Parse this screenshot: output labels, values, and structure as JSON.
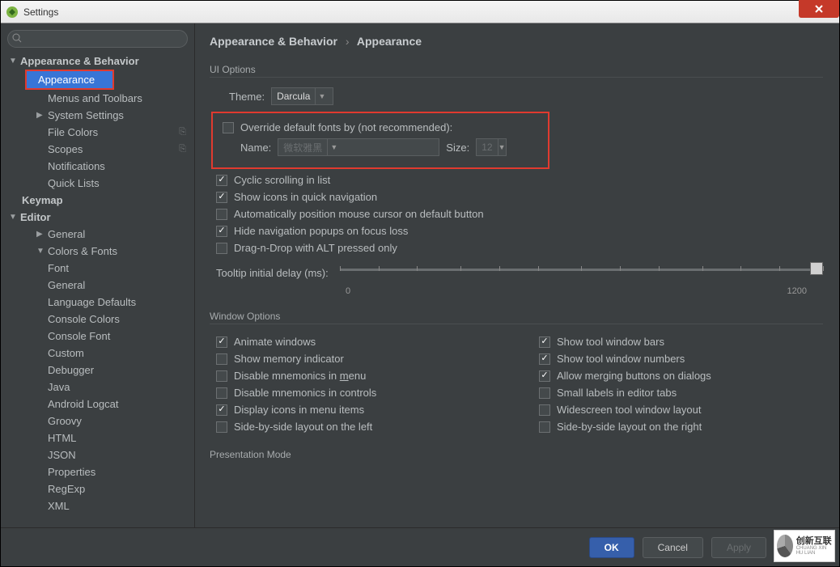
{
  "window": {
    "title": "Settings"
  },
  "search": {
    "placeholder": ""
  },
  "sidebar": {
    "items": [
      {
        "label": "Appearance & Behavior",
        "bold": true,
        "arrow": "▼",
        "lvl": 0
      },
      {
        "label": "Appearance",
        "lvl": 2,
        "selected": true,
        "redbox": true
      },
      {
        "label": "Menus and Toolbars",
        "lvl": 2
      },
      {
        "label": "System Settings",
        "lvl": 2,
        "arrow": "▶"
      },
      {
        "label": "File Colors",
        "lvl": 2,
        "trail": "⎘"
      },
      {
        "label": "Scopes",
        "lvl": 2,
        "trail": "⎘"
      },
      {
        "label": "Notifications",
        "lvl": 2
      },
      {
        "label": "Quick Lists",
        "lvl": 2
      },
      {
        "label": "Keymap",
        "bold": true,
        "lvl": 1
      },
      {
        "label": "Editor",
        "bold": true,
        "arrow": "▼",
        "lvl": 0
      },
      {
        "label": "General",
        "lvl": 2,
        "arrow": "▶"
      },
      {
        "label": "Colors & Fonts",
        "lvl": 2,
        "arrow": "▼"
      },
      {
        "label": "Font",
        "lvl": 3
      },
      {
        "label": "General",
        "lvl": 3
      },
      {
        "label": "Language Defaults",
        "lvl": 3
      },
      {
        "label": "Console Colors",
        "lvl": 3
      },
      {
        "label": "Console Font",
        "lvl": 3
      },
      {
        "label": "Custom",
        "lvl": 3
      },
      {
        "label": "Debugger",
        "lvl": 3
      },
      {
        "label": "Java",
        "lvl": 3
      },
      {
        "label": "Android Logcat",
        "lvl": 3
      },
      {
        "label": "Groovy",
        "lvl": 3
      },
      {
        "label": "HTML",
        "lvl": 3
      },
      {
        "label": "JSON",
        "lvl": 3
      },
      {
        "label": "Properties",
        "lvl": 3
      },
      {
        "label": "RegExp",
        "lvl": 3
      },
      {
        "label": "XML",
        "lvl": 3
      }
    ]
  },
  "breadcrumb": {
    "a": "Appearance & Behavior",
    "b": "Appearance"
  },
  "ui_options": {
    "section": "UI Options",
    "theme_label": "Theme:",
    "theme_value": "Darcula",
    "override_label": "Override default fonts by (not recommended):",
    "name_label": "Name:",
    "name_value": "微软雅黑",
    "size_label": "Size:",
    "size_value": "12",
    "cyclic": "Cyclic scrolling in list",
    "showicons": "Show icons in quick navigation",
    "autopos": "Automatically position mouse cursor on default button",
    "hidenav": "Hide navigation popups on focus loss",
    "dragdrop": "Drag-n-Drop with ALT pressed only",
    "tooltip_label": "Tooltip initial delay (ms):",
    "slider_min": "0",
    "slider_max": "1200"
  },
  "win_options": {
    "section": "Window Options",
    "animate": "Animate windows",
    "memind": "Show memory indicator",
    "dismenu_pre": "Disable mnemonics in ",
    "dismenu_u": "m",
    "dismenu_post": "enu",
    "disctrl": "Disable mnemonics in controls",
    "dispicons": "Display icons in menu items",
    "sbsleft": "Side-by-side layout on the left",
    "showbars": "Show tool window bars",
    "shownums": "Show tool window numbers",
    "allowmerge": "Allow merging buttons on dialogs",
    "smalllabels": "Small labels in editor tabs",
    "widescreen": "Widescreen tool window layout",
    "sbsright": "Side-by-side layout on the right"
  },
  "presentation": {
    "section": "Presentation Mode"
  },
  "footer": {
    "ok": "OK",
    "cancel": "Cancel",
    "apply": "Apply"
  },
  "watermark": {
    "main": "创新互联",
    "sub": "CHUANG XIN HU LIAN"
  }
}
